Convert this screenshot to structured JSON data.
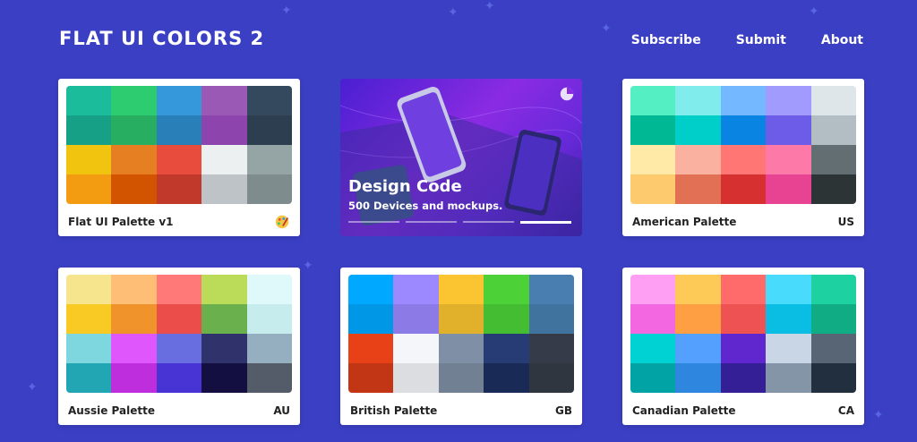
{
  "header": {
    "logo": "FLAT UI COLORS 2",
    "nav": [
      {
        "label": "Subscribe"
      },
      {
        "label": "Submit"
      },
      {
        "label": "About"
      }
    ]
  },
  "ad": {
    "title": "Design Code",
    "subtitle": "500 Devices and mockups.",
    "slides": 4,
    "active_slide": 3
  },
  "palettes": [
    {
      "name": "Flat UI Palette v1",
      "code": "",
      "icon": "palette-icon",
      "colors": [
        "#1abc9c",
        "#2ecc71",
        "#3498db",
        "#9b59b6",
        "#34495e",
        "#16a085",
        "#27ae60",
        "#2980b9",
        "#8e44ad",
        "#2c3e50",
        "#f1c40f",
        "#e67e22",
        "#e74c3c",
        "#ecf0f1",
        "#95a5a6",
        "#f39c12",
        "#d35400",
        "#c0392b",
        "#bdc3c7",
        "#7f8c8d"
      ]
    },
    {
      "name": "American Palette",
      "code": "US",
      "colors": [
        "#55efc4",
        "#81ecec",
        "#74b9ff",
        "#a29bfe",
        "#dfe6e9",
        "#00b894",
        "#00cec9",
        "#0984e3",
        "#6c5ce7",
        "#b2bec3",
        "#ffeaa7",
        "#fab1a0",
        "#ff7675",
        "#fd79a8",
        "#636e72",
        "#fdcb6e",
        "#e17055",
        "#d63031",
        "#e84393",
        "#2d3436"
      ]
    },
    {
      "name": "Aussie Palette",
      "code": "AU",
      "colors": [
        "#f6e58d",
        "#ffbe76",
        "#ff7979",
        "#badc58",
        "#dff9fb",
        "#f9ca24",
        "#f0932b",
        "#eb4d4b",
        "#6ab04c",
        "#c7ecee",
        "#7ed6df",
        "#e056fd",
        "#686de0",
        "#30336b",
        "#95afc0",
        "#22a6b3",
        "#be2edd",
        "#4834d4",
        "#130f40",
        "#535c68"
      ]
    },
    {
      "name": "British Palette",
      "code": "GB",
      "colors": [
        "#00a8ff",
        "#9c88ff",
        "#fbc531",
        "#4cd137",
        "#487eb0",
        "#0097e6",
        "#8c7ae6",
        "#e1b12c",
        "#44bd32",
        "#40739e",
        "#e84118",
        "#f5f6fa",
        "#7f8fa6",
        "#273c75",
        "#353b48",
        "#c23616",
        "#dcdde1",
        "#718093",
        "#192a56",
        "#2f3640"
      ]
    },
    {
      "name": "Canadian Palette",
      "code": "CA",
      "colors": [
        "#ff9ff3",
        "#feca57",
        "#ff6b6b",
        "#48dbfb",
        "#1dd1a1",
        "#f368e0",
        "#ff9f43",
        "#ee5253",
        "#0abde3",
        "#10ac84",
        "#00d2d3",
        "#54a0ff",
        "#5f27cd",
        "#c8d6e5",
        "#576574",
        "#01a3a4",
        "#2e86de",
        "#341f97",
        "#8395a7",
        "#222f3e"
      ]
    }
  ]
}
